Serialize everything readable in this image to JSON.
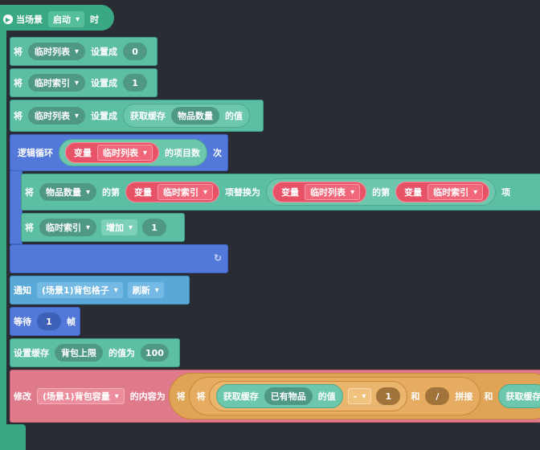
{
  "hat": {
    "prefix": "当场景",
    "scene": "启动",
    "suffix": "时"
  },
  "blocks": {
    "b1": {
      "verb": "将",
      "var": "临时列表",
      "op": "设置成",
      "value": "0"
    },
    "b2": {
      "verb": "将",
      "var": "临时索引",
      "op": "设置成",
      "value": "1"
    },
    "b3": {
      "verb": "将",
      "var": "临时列表",
      "op": "设置成",
      "get": "获取缓存",
      "key": "物品数量",
      "suffix": "的值"
    },
    "loop": {
      "label": "逻辑循环",
      "var_label": "变量",
      "var": "临时列表",
      "count": "的项目数",
      "times": "次"
    },
    "b4": {
      "verb": "将",
      "list": "物品数量",
      "nth": "的第",
      "var_label1": "变量",
      "var1": "临时索引",
      "replace": "项替换为",
      "var_label2": "变量",
      "var2": "临时列表",
      "nth2": "的第",
      "var_label3": "变量",
      "var3": "临时索引",
      "item": "项"
    },
    "b5": {
      "verb": "将",
      "var": "临时索引",
      "op": "增加",
      "value": "1"
    },
    "notify": {
      "label": "通知",
      "target": "(场景1)背包格子",
      "action": "刷新"
    },
    "wait": {
      "label": "等待",
      "value": "1",
      "unit": "帧"
    },
    "cache": {
      "label": "设置缓存",
      "key": "背包上限",
      "mid": "的值为",
      "value": "100"
    },
    "modify": {
      "label": "修改",
      "target": "(场景1)背包容量",
      "mid": "的内容为",
      "verb1": "将",
      "verb2": "将",
      "get": "获取缓存",
      "key": "已有物品",
      "suffix": "的值",
      "op": "-",
      "n1": "1",
      "and1": "和",
      "slash": "/",
      "concat": "拼接",
      "and2": "和",
      "get2": "获取缓存"
    }
  },
  "colors": {
    "background": "#2a2c33",
    "event": "#3aa885",
    "motion": "#5cbfa4",
    "control": "#5279da",
    "text": "#df7a8b",
    "variable": "#e85266",
    "operator": "#e0a456"
  }
}
